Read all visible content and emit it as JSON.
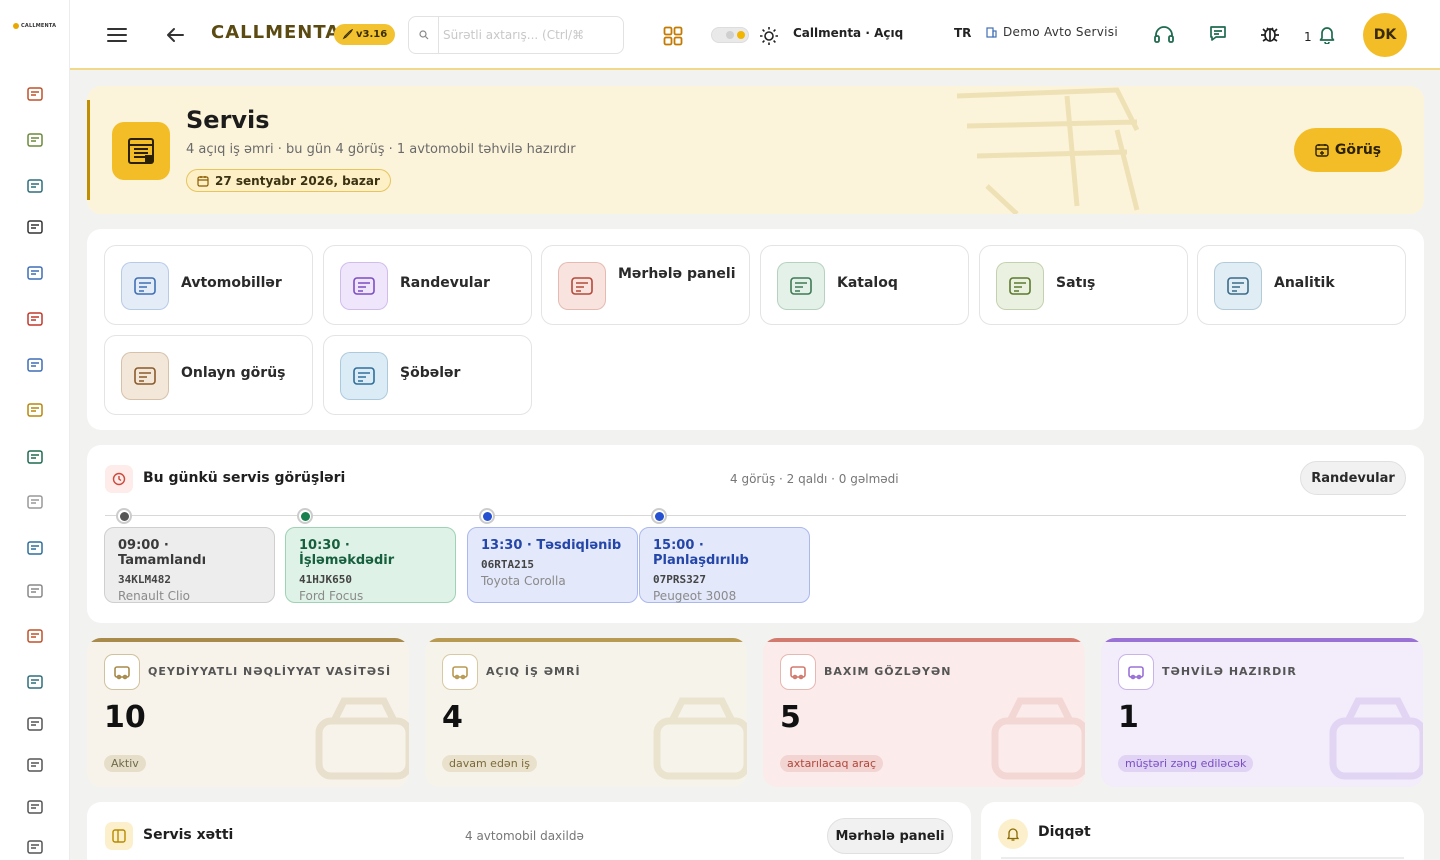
{
  "app": {
    "logo_text": "CALLMENTA",
    "brand": "CALLMENTA",
    "version": "v3.16"
  },
  "header": {
    "search_placeholder": "Sürətli axtarış... (Ctrl/⌘",
    "theme_label": "Callmenta · Açıq",
    "language": "TR",
    "organization": "Demo Avto Servisi",
    "notification_count": "1",
    "avatar_initials": "DK"
  },
  "sidebar": {
    "icons": [
      "dashboard-icon",
      "clipboard-icon",
      "board-icon",
      "bracket-icon",
      "contact-icon",
      "alarm-icon",
      "users-chat-icon",
      "medal-icon",
      "megaphone-icon",
      "settings-icon",
      "grid-icon",
      "shield-icon",
      "building-icon",
      "chart-icon",
      "globe-icon",
      "sliders-icon",
      "report-icon",
      "warning-icon"
    ]
  },
  "hero": {
    "title": "Servis",
    "subtitle": "4 açıq iş əmri · bu gün 4 görüş · 1 avtomobil təhvilə hazırdır",
    "date": "27 sentyabr 2026, bazar",
    "button_label": "Görüş"
  },
  "tiles": [
    {
      "label": "Avtomobillər",
      "icon": "car-icon",
      "color": "#3f6fb5",
      "bg": "#e4ecf8"
    },
    {
      "label": "Randevular",
      "icon": "calendar-clock-icon",
      "color": "#7d4dc4",
      "bg": "#efe6fb"
    },
    {
      "label": "Mərhələ paneli",
      "icon": "checklist-icon",
      "color": "#b34a3a",
      "bg": "#f8e3df"
    },
    {
      "label": "Kataloq",
      "icon": "catalog-icon",
      "color": "#3f7a55",
      "bg": "#e3f1e8"
    },
    {
      "label": "Satış",
      "icon": "price-tag-icon",
      "color": "#5b7a2e",
      "bg": "#ebf1e0"
    },
    {
      "label": "Analitik",
      "icon": "analytics-icon",
      "color": "#3a6b8a",
      "bg": "#e0edf4"
    },
    {
      "label": "Onlayn görüş",
      "icon": "calendar-grid-icon",
      "color": "#8a5a2a",
      "bg": "#f3e7da"
    },
    {
      "label": "Şöbələr",
      "icon": "department-icon",
      "color": "#2e6e9b",
      "bg": "#dcecf6"
    }
  ],
  "schedule": {
    "title": "Bu günkü servis görüşləri",
    "summary": "4 görüş · 2 qaldı · 0 gəlmədi",
    "button_label": "Randevular",
    "items": [
      {
        "time_status": "09:00 · Tamamlandı",
        "plate": "34KLM482",
        "car": "Renault Clio",
        "status": "completed"
      },
      {
        "time_status": "10:30 · İşləməkdədir",
        "plate": "41HJK650",
        "car": "Ford Focus",
        "status": "in-progress"
      },
      {
        "time_status": "13:30 · Təsdiqlənib",
        "plate": "06RTA215",
        "car": "Toyota Corolla",
        "status": "confirmed"
      },
      {
        "time_status": "15:00 · Planlaşdırılıb",
        "plate": "07PRS327",
        "car": "Peugeot 3008",
        "status": "planned"
      }
    ]
  },
  "stats": [
    {
      "label": "QEYDİYYATLI NƏQLİYYAT VASİTƏSİ",
      "value": "10",
      "badge": "Aktiv",
      "accent": "#a88a4a",
      "bg": "#f7f3ea",
      "icon": "car-icon"
    },
    {
      "label": "AÇIQ İŞ ƏMRİ",
      "value": "4",
      "badge": "davam edən iş",
      "accent": "#b89a52",
      "bg": "#f6f3ea",
      "icon": "tools-icon"
    },
    {
      "label": "BAXIM GÖZLƏYƏN",
      "value": "5",
      "badge": "axtarılacaq araç",
      "accent": "#d27a6e",
      "bg": "#fbeceb",
      "icon": "bell-icon"
    },
    {
      "label": "TƏHVİLƏ HAZIRDIR",
      "value": "1",
      "badge": "müştəri zəng ediləcək",
      "accent": "#9a72d6",
      "bg": "#f2ecfb",
      "icon": "key-icon"
    }
  ],
  "pipeline": {
    "title": "Servis xətti",
    "subtitle": "4 avtomobil daxildə",
    "button_label": "Mərhələ paneli"
  },
  "attention": {
    "title": "Diqqət"
  }
}
